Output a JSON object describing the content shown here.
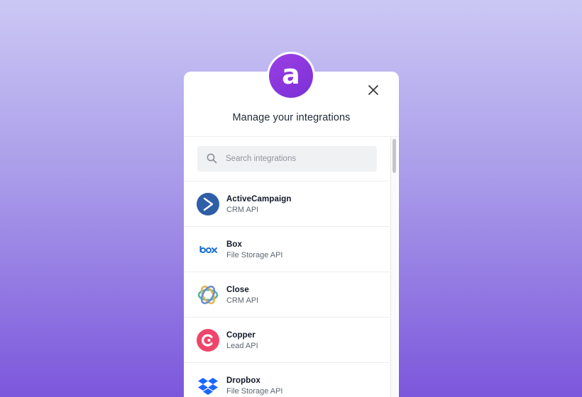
{
  "modal": {
    "title": "Manage your integrations",
    "close_icon": "close-icon",
    "logo_icon": "brand-a-logo",
    "logo_letter": "a"
  },
  "search": {
    "placeholder": "Search integrations",
    "icon": "search-icon"
  },
  "integrations": [
    {
      "name": "ActiveCampaign",
      "category": "CRM API",
      "icon": "activecampaign-icon"
    },
    {
      "name": "Box",
      "category": "File Storage API",
      "icon": "box-icon"
    },
    {
      "name": "Close",
      "category": "CRM API",
      "icon": "close-crm-icon"
    },
    {
      "name": "Copper",
      "category": "Lead API",
      "icon": "copper-icon"
    },
    {
      "name": "Dropbox",
      "category": "File Storage API",
      "icon": "dropbox-icon"
    }
  ],
  "colors": {
    "brand": "#8a38de",
    "activecampaign": "#2f5ea8",
    "box": "#1b6fd3",
    "copper": "#f0456a",
    "dropbox": "#1a66ff"
  }
}
